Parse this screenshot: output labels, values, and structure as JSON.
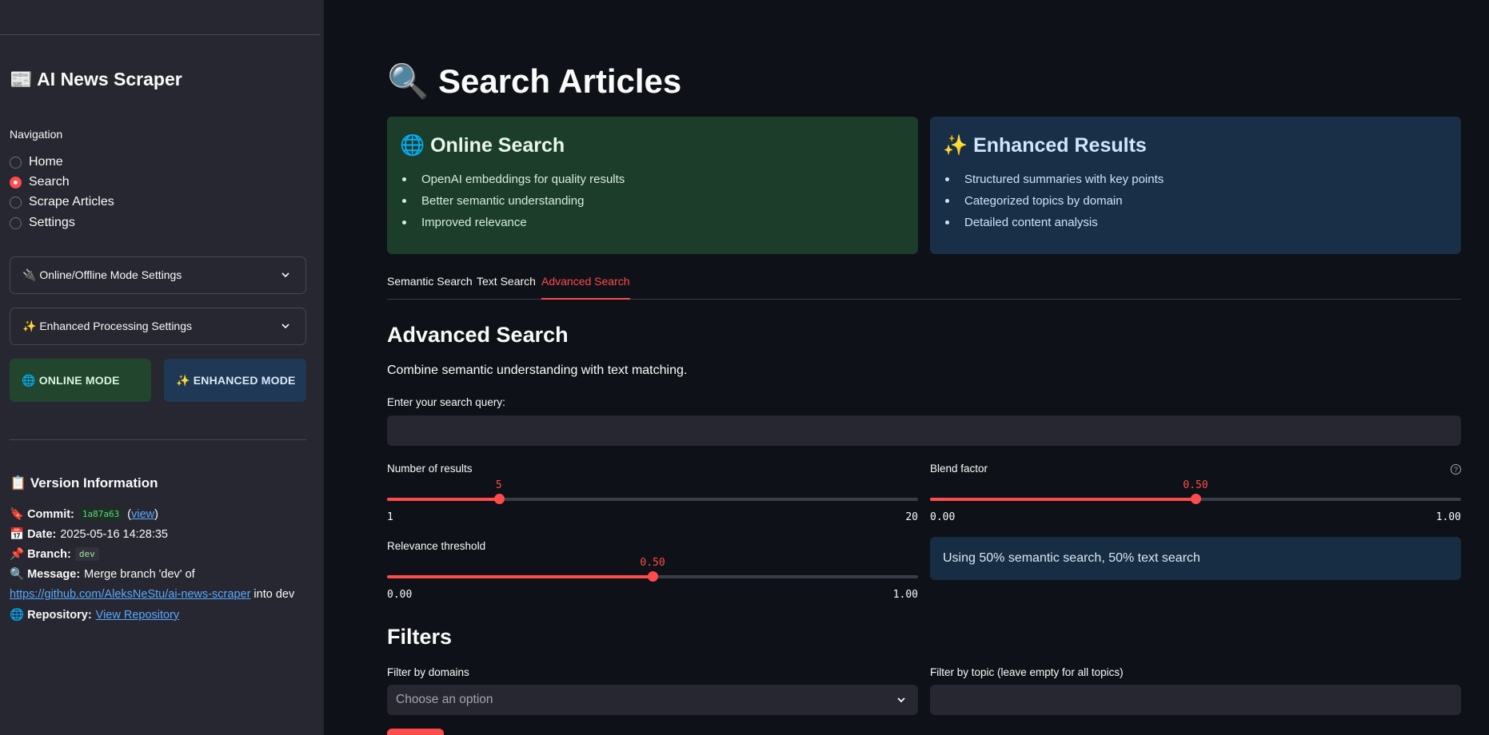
{
  "sidebar": {
    "title": "📰 AI News Scraper",
    "nav_label": "Navigation",
    "nav_items": [
      {
        "label": "Home",
        "selected": false
      },
      {
        "label": "Search",
        "selected": true
      },
      {
        "label": "Scrape Articles",
        "selected": false
      },
      {
        "label": "Settings",
        "selected": false
      }
    ],
    "expanders": [
      {
        "label": "🔌 Online/Offline Mode Settings"
      },
      {
        "label": "✨ Enhanced Processing Settings"
      }
    ],
    "online_mode_label": "🌐 ONLINE MODE",
    "enhanced_mode_label": "✨ ENHANCED MODE",
    "version": {
      "title": "📋 Version Information",
      "commit_label": "🔖 Commit:",
      "commit_hash": "1a87a63",
      "commit_open_paren": "(",
      "commit_view_link": "view",
      "commit_close_paren": ")",
      "date_label": "📅 Date:",
      "date_value": "2025-05-16 14:28:35",
      "branch_label": "📌 Branch:",
      "branch_value": "dev",
      "message_label": "🔍 Message:",
      "message_value": "Merge branch 'dev' of",
      "message_link": "https://github.com/AleksNeStu/ai-news-scraper",
      "message_suffix": "into dev",
      "repo_label": "🌐 Repository:",
      "repo_link": "View Repository"
    }
  },
  "main": {
    "title": "🔍 Search Articles",
    "online_card": {
      "title": "🌐 Online Search",
      "items": [
        "OpenAI embeddings for quality results",
        "Better semantic understanding",
        "Improved relevance"
      ]
    },
    "enhanced_card": {
      "title": "✨ Enhanced Results",
      "items": [
        "Structured summaries with key points",
        "Categorized topics by domain",
        "Detailed content analysis"
      ]
    },
    "tabs": [
      {
        "label": "Semantic Search",
        "active": false
      },
      {
        "label": "Text Search",
        "active": false
      },
      {
        "label": "Advanced Search",
        "active": true
      }
    ],
    "section_title": "Advanced Search",
    "section_desc": "Combine semantic understanding with text matching.",
    "query_label": "Enter your search query:",
    "query_value": "",
    "num_results": {
      "label": "Number of results",
      "value": "5",
      "min": "1",
      "max": "20",
      "fraction": 0.2105
    },
    "blend": {
      "label": "Blend factor",
      "value": "0.50",
      "min": "0.00",
      "max": "1.00",
      "fraction": 0.5
    },
    "relevance": {
      "label": "Relevance threshold",
      "value": "0.50",
      "min": "0.00",
      "max": "1.00",
      "fraction": 0.5
    },
    "help_icon": "?",
    "blend_info": "Using 50% semantic search, 50% text search",
    "filters_title": "Filters",
    "domains_label": "Filter by domains",
    "domains_placeholder": "Choose an option",
    "topic_label": "Filter by topic (leave empty for all topics)",
    "topic_value": ""
  },
  "colors": {
    "accent": "#ff4b4b",
    "background": "#0e1117",
    "sidebar": "#262730",
    "link": "#5aa9ff"
  }
}
